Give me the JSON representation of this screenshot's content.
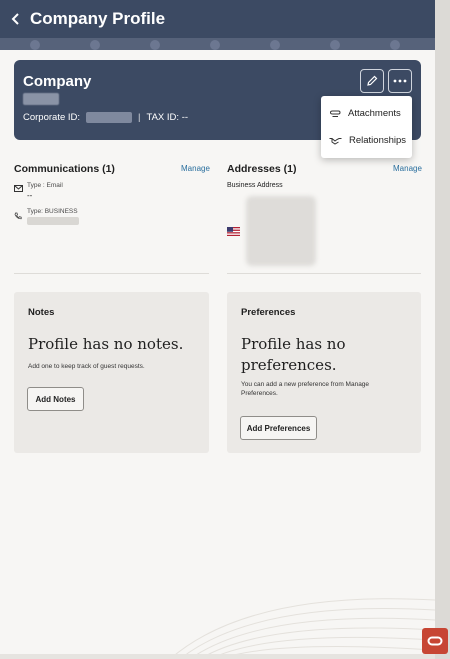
{
  "header": {
    "title": "Company Profile"
  },
  "company": {
    "name": "Company",
    "corporate_id_label": "Corporate ID:",
    "separator": "|",
    "tax_id_label": "TAX ID: --"
  },
  "menu": {
    "items": [
      {
        "label": "Attachments",
        "icon": "paperclip-icon"
      },
      {
        "label": "Relationships",
        "icon": "handshake-icon"
      }
    ]
  },
  "communications": {
    "title": "Communications (1)",
    "manage_label": "Manage",
    "email_type": "Type : Email",
    "email_value": "--",
    "phone_type": "Type: BUSINESS"
  },
  "addresses": {
    "title": "Addresses (1)",
    "manage_label": "Manage",
    "address_type": "Business Address"
  },
  "notes": {
    "title": "Notes",
    "empty_heading": "Profile has no notes.",
    "empty_desc": "Add one to keep track of guest requests.",
    "button_label": "Add Notes"
  },
  "preferences": {
    "title": "Preferences",
    "empty_heading_line1": "Profile has no",
    "empty_heading_line2": "preferences.",
    "empty_desc_line1": "You can add a new preference from Manage",
    "empty_desc_line2": "Preferences.",
    "button_label": "Add Preferences"
  },
  "colors": {
    "header_bg": "#3c4a63",
    "link": "#2a6f9e",
    "oracle_brand": "#c74634"
  }
}
